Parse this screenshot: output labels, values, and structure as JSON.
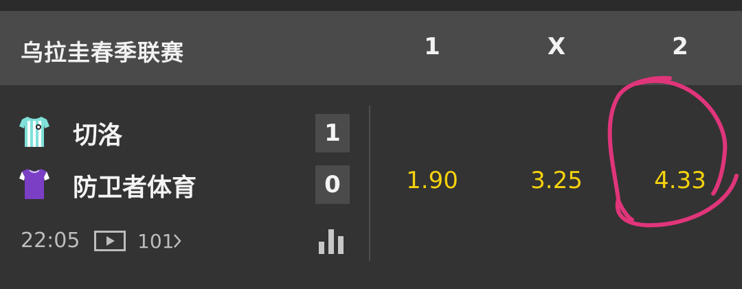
{
  "league": {
    "title": "乌拉圭春季联赛",
    "columns": [
      "1",
      "X",
      "2"
    ]
  },
  "match": {
    "home": {
      "name": "切洛",
      "score": "1",
      "jersey_icon": "striped-jersey-icon",
      "jersey_color": "#7fe0d8"
    },
    "away": {
      "name": "防卫者体育",
      "score": "0",
      "jersey_icon": "jersey-icon",
      "jersey_color": "#7a3fc4"
    },
    "time": "22:05",
    "video_icon": "play-video-icon",
    "more_markets": "101",
    "stats_icon": "bar-chart-icon"
  },
  "odds": {
    "home": "1.90",
    "draw": "3.25",
    "away": "4.33"
  },
  "colors": {
    "background": "#333333",
    "header": "#4a4a4a",
    "odds_text": "#f5d20d",
    "annotation": "#e0357a"
  }
}
